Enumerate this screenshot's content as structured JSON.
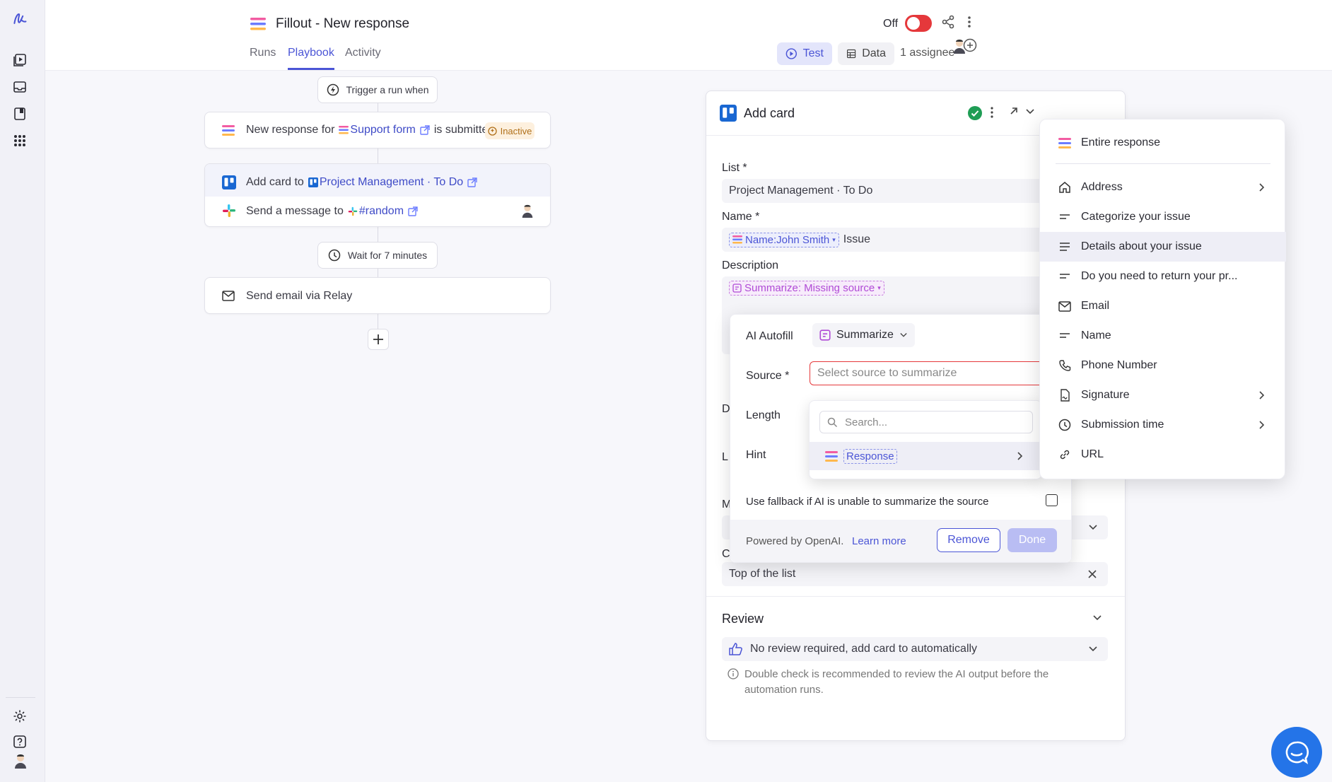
{
  "app": {
    "title": "Fillout - New response"
  },
  "header": {
    "toggle_label": "Off",
    "tabs": [
      {
        "label": "Runs"
      },
      {
        "label": "Playbook"
      },
      {
        "label": "Activity"
      }
    ],
    "test_label": "Test",
    "data_label": "Data",
    "assignee_label": "1 assignee"
  },
  "flow": {
    "trigger_label": "Trigger a run when",
    "trigger_card": {
      "prefix": "New response for",
      "form_name": "Support form",
      "suffix": "is submitted",
      "status": "Inactive"
    },
    "step_add_card": {
      "prefix": "Add card to",
      "target": "Project Management · To Do"
    },
    "step_message": {
      "prefix": "Send a message to",
      "channel": "#random"
    },
    "wait_label": "Wait for 7 minutes",
    "email_step": "Send email via Relay"
  },
  "panel": {
    "title": "Add card",
    "list_label": "List *",
    "list_value": "Project Management · To Do",
    "name_label": "Name *",
    "name_chip": "Name:John Smith",
    "name_suffix": "Issue",
    "description_label": "Description",
    "description_chip": "Summarize: Missing source",
    "partial_labels": [
      "D",
      "L",
      "M",
      "C"
    ],
    "position_value": "Top of the list",
    "review_title": "Review",
    "review_value": "No review required, add card to automatically",
    "review_note": "Double check is recommended to review the AI output before the automation runs."
  },
  "ai_popup": {
    "autofill_label": "AI Autofill",
    "mode_value": "Summarize",
    "source_label": "Source *",
    "source_placeholder": "Select source to summarize",
    "length_label": "Length",
    "hint_label": "Hint",
    "fallback_label": "Use fallback if AI is unable to summarize the source",
    "powered_by": "Powered by OpenAI.",
    "learn_more": "Learn more",
    "remove_label": "Remove",
    "done_label": "Done"
  },
  "source_dropdown": {
    "search_placeholder": "Search...",
    "option": "Response"
  },
  "field_menu": {
    "items": [
      {
        "label": "Entire response",
        "icon": "fillout-logo-icon"
      },
      {
        "label": "Address",
        "icon": "home-icon"
      },
      {
        "label": "Categorize your issue",
        "icon": "text-lines-icon"
      },
      {
        "label": "Details about your issue",
        "icon": "paragraph-icon"
      },
      {
        "label": "Do you need to return your pr...",
        "icon": "text-lines-icon"
      },
      {
        "label": "Email",
        "icon": "envelope-icon"
      },
      {
        "label": "Name",
        "icon": "text-lines-icon"
      },
      {
        "label": "Phone Number",
        "icon": "phone-icon"
      },
      {
        "label": "Signature",
        "icon": "signature-icon"
      },
      {
        "label": "Submission time",
        "icon": "clock-icon"
      },
      {
        "label": "URL",
        "icon": "link-icon"
      }
    ]
  },
  "colors": {
    "accent": "#4b55d6",
    "toggle_off": "#e5383b",
    "success": "#1f9d55",
    "ai_purple": "#b04bd6",
    "trello_blue": "#1967d2"
  }
}
